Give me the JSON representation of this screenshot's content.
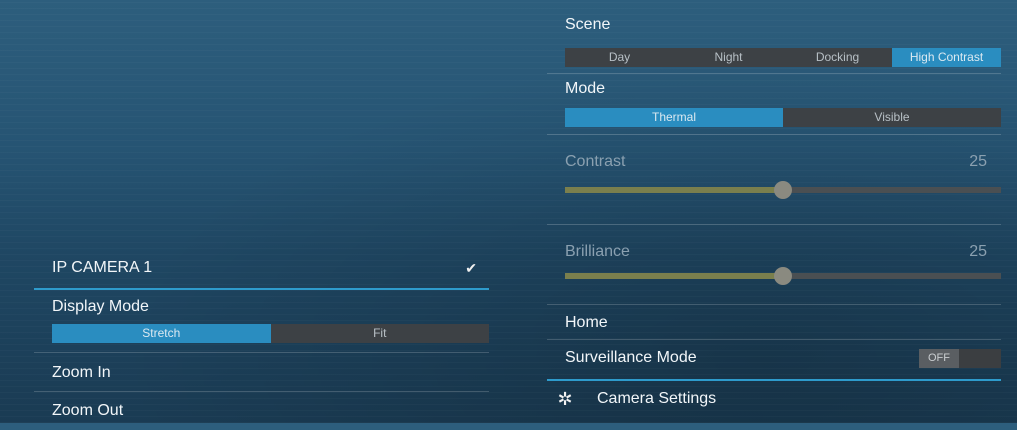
{
  "camera": {
    "name": "IP CAMERA 1",
    "selected": true
  },
  "display_mode": {
    "label": "Display Mode",
    "options": [
      "Stretch",
      "Fit"
    ],
    "active": "Stretch"
  },
  "zoom": {
    "in_label": "Zoom In",
    "out_label": "Zoom Out"
  },
  "scene": {
    "label": "Scene",
    "options": [
      "Day",
      "Night",
      "Docking",
      "High Contrast"
    ],
    "active": "High Contrast"
  },
  "mode": {
    "label": "Mode",
    "options": [
      "Thermal",
      "Visible"
    ],
    "active": "Thermal"
  },
  "contrast": {
    "label": "Contrast",
    "value": "25",
    "level": 0.5
  },
  "brilliance": {
    "label": "Brilliance",
    "value": "25",
    "level": 0.5
  },
  "home": {
    "label": "Home"
  },
  "surveillance": {
    "label": "Surveillance Mode",
    "state": "OFF"
  },
  "camera_settings": {
    "label": "Camera Settings",
    "icon": "gear-icon"
  },
  "colors": {
    "accent": "#2e9bcc",
    "active_segment": "#2a8dc0",
    "inactive_segment": "#3d4145"
  }
}
